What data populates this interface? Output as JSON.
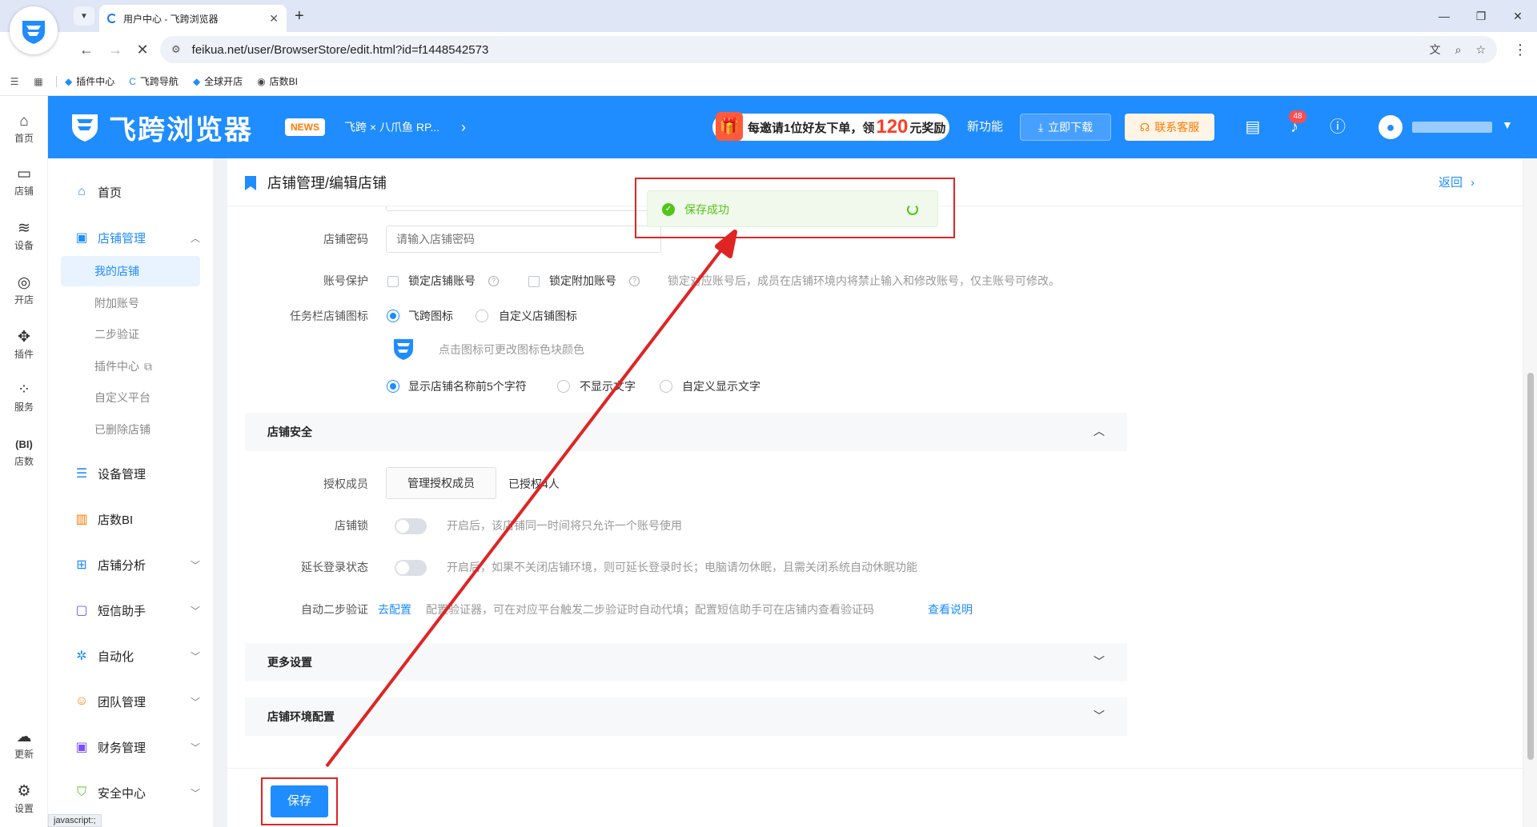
{
  "browser": {
    "tab_title": "用户中心 - 飞跨浏览器",
    "url": "feikua.net/user/BrowserStore/edit.html?id=f1448542573",
    "bookmarks": [
      {
        "label": "插件中心"
      },
      {
        "label": "飞跨导航"
      },
      {
        "label": "全球开店"
      },
      {
        "label": "店数BI"
      }
    ],
    "status_text": "javascript:;"
  },
  "header": {
    "brand": "飞跨浏览器",
    "news_badge": "NEWS",
    "news_text": "飞跨 × 八爪鱼 RP...",
    "invite_pre": "每邀请1位好友下单，领",
    "invite_amount": "120",
    "invite_post": "元奖励",
    "new_feature": "新功能",
    "download": "立即下载",
    "contact": "联系客服",
    "notification_count": "48"
  },
  "rail": [
    {
      "label": "首页",
      "icon": "home-icon"
    },
    {
      "label": "店铺",
      "icon": "store-icon"
    },
    {
      "label": "设备",
      "icon": "layers-icon"
    },
    {
      "label": "开店",
      "icon": "globe-icon"
    },
    {
      "label": "插件",
      "icon": "puzzle-icon"
    },
    {
      "label": "服务",
      "icon": "grid-icon"
    },
    {
      "label": "店数",
      "icon": "bi-icon"
    },
    {
      "label": "更新",
      "icon": "cloud-upload-icon"
    },
    {
      "label": "设置",
      "icon": "settings-icon"
    }
  ],
  "menu": {
    "home": "首页",
    "store_mgmt": "店铺管理",
    "subs": [
      "我的店铺",
      "附加账号",
      "二步验证",
      "插件中心",
      "自定义平台",
      "已删除店铺"
    ],
    "device_mgmt": "设备管理",
    "bi": "店数BI",
    "analysis": "店铺分析",
    "sms": "短信助手",
    "automation": "自动化",
    "team": "团队管理",
    "finance": "财务管理",
    "security": "安全中心"
  },
  "page": {
    "title": "店铺管理/编辑店铺",
    "back": "返回",
    "pwd_label": "店铺密码",
    "pwd_placeholder": "请输入店铺密码",
    "acct_label": "账号保护",
    "lock_store": "锁定店铺账号",
    "lock_extra": "锁定附加账号",
    "lock_hint": "锁定对应账号后，成员在店铺环境内将禁止输入和修改账号，仅主账号可修改。",
    "icon_label": "任务栏店铺图标",
    "icon_opt1": "飞跨图标",
    "icon_opt2": "自定义店铺图标",
    "icon_hint": "点击图标可更改图标色块颜色",
    "text_opt1": "显示店铺名称前5个字符",
    "text_opt2": "不显示文字",
    "text_opt3": "自定义显示文字",
    "sec_security": "店铺安全",
    "auth_label": "授权成员",
    "auth_btn": "管理授权成员",
    "auth_count": "已授权4人",
    "lock_label": "店铺锁",
    "lock_desc": "开启后，该店铺同一时间将只允许一个账号使用",
    "extend_label": "延长登录状态",
    "extend_desc": "开启后，如果不关闭店铺环境，则可延长登录时长；电脑请勿休眠，且需关闭系统自动休眠功能",
    "auto2fa_label": "自动二步验证",
    "auto2fa_link": "去配置",
    "auto2fa_desc": "配置验证器，可在对应平台触发二步验证时自动代填；配置短信助手可在店铺内查看验证码",
    "auto2fa_help": "查看说明",
    "sec_more": "更多设置",
    "sec_env": "店铺环境配置",
    "save": "保存"
  },
  "toast": {
    "text": "保存成功"
  },
  "colors": {
    "primary": "#1f8cff",
    "success": "#52c41a",
    "annotation": "#e02424"
  }
}
